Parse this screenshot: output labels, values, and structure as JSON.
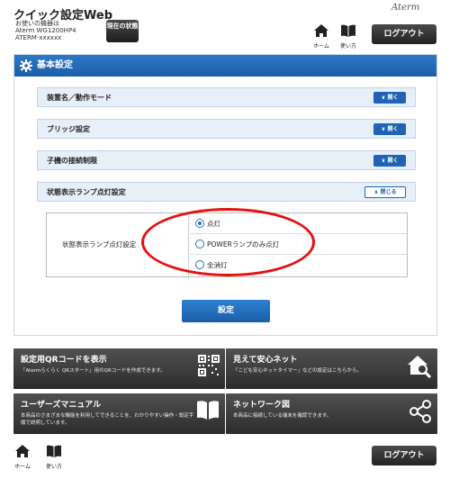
{
  "header": {
    "app_title": "クイック設定Web",
    "device_label": "お使いの機器は",
    "device_model": "Aterm WG1200HP4",
    "device_name": "ATERM-xxxxxx",
    "status_button": "現在の状態",
    "brand": "Aterm",
    "home_label": "ホーム",
    "manual_label": "使い方",
    "logout": "ログアウト"
  },
  "main": {
    "section_title": "基本設定",
    "accordions": [
      {
        "label": "装置名／動作モード",
        "button": "開く",
        "state": "closed"
      },
      {
        "label": "ブリッジ設定",
        "button": "開く",
        "state": "closed"
      },
      {
        "label": "子機の接続制限",
        "button": "開く",
        "state": "closed"
      },
      {
        "label": "状態表示ランプ点灯設定",
        "button": "閉じる",
        "state": "open"
      }
    ],
    "setting_label": "状態表示ランプ点灯設定",
    "options": [
      {
        "label": "点灯",
        "selected": true
      },
      {
        "label": "POWERランプのみ点灯",
        "selected": false
      },
      {
        "label": "全消灯",
        "selected": false
      }
    ],
    "submit": "設定"
  },
  "tiles": [
    {
      "title": "設定用QRコードを表示",
      "desc": "「Atermらくらく QRスタート」用のQRコードを作成できます。",
      "icon": "qr-code-icon"
    },
    {
      "title": "見えて安心ネット",
      "desc": "「こども安心ネットタイマー」などの設定はこちらから。",
      "icon": "home-search-icon"
    },
    {
      "title": "ユーザーズマニュアル",
      "desc": "本商品のさまざまな機能を利用してできることを、わかりやすい操作・設定手順で説明しています。",
      "icon": "book-icon"
    },
    {
      "title": "ネットワーク図",
      "desc": "本商品に接続している端末を確認できます。",
      "icon": "network-icon"
    }
  ],
  "footer": {
    "home_label": "ホーム",
    "manual_label": "使い方",
    "logout": "ログアウト"
  },
  "colors": {
    "accent_blue": "#1f64b4",
    "highlight_red": "#e51010",
    "tile_dark": "#3a3a3a"
  }
}
